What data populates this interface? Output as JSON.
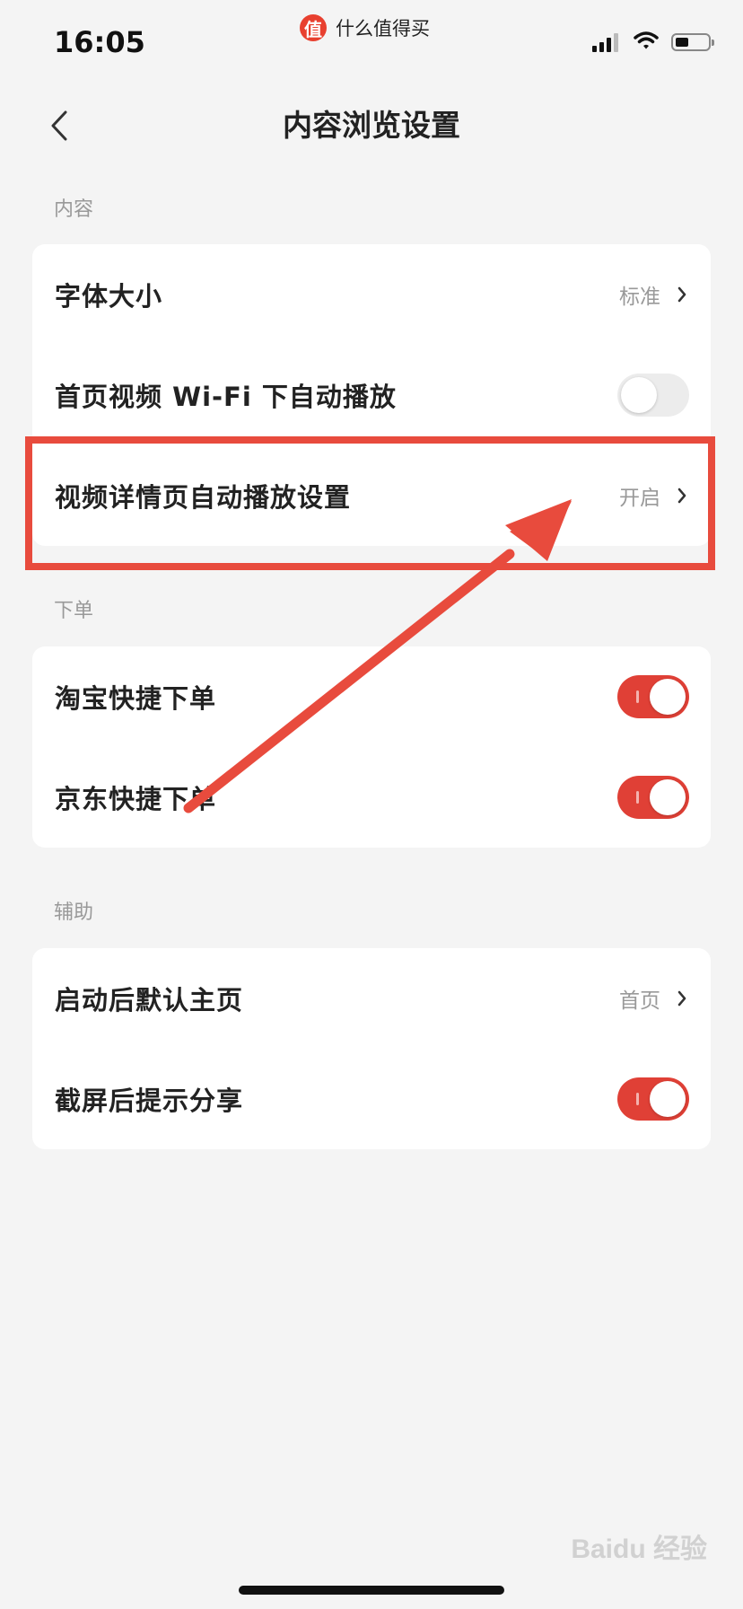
{
  "status_bar": {
    "time": "16:05",
    "app_logo_char": "值",
    "app_name": "什么值得买"
  },
  "nav": {
    "title": "内容浏览设置"
  },
  "sections": [
    {
      "label": "内容",
      "rows": [
        {
          "label": "字体大小",
          "value": "标准",
          "type": "link"
        },
        {
          "label": "首页视频 Wi-Fi 下自动播放",
          "type": "toggle",
          "on": false
        },
        {
          "label": "视频详情页自动播放设置",
          "value": "开启",
          "type": "link"
        }
      ]
    },
    {
      "label": "下单",
      "rows": [
        {
          "label": "淘宝快捷下单",
          "type": "toggle",
          "on": true
        },
        {
          "label": "京东快捷下单",
          "type": "toggle",
          "on": true
        }
      ]
    },
    {
      "label": "辅助",
      "rows": [
        {
          "label": "启动后默认主页",
          "value": "首页",
          "type": "link"
        },
        {
          "label": "截屏后提示分享",
          "type": "toggle",
          "on": true
        }
      ]
    }
  ],
  "colors": {
    "accent": "#e04036",
    "annotation": "#e84b3d",
    "background": "#f4f4f4"
  },
  "watermark": "Baidu 经验"
}
